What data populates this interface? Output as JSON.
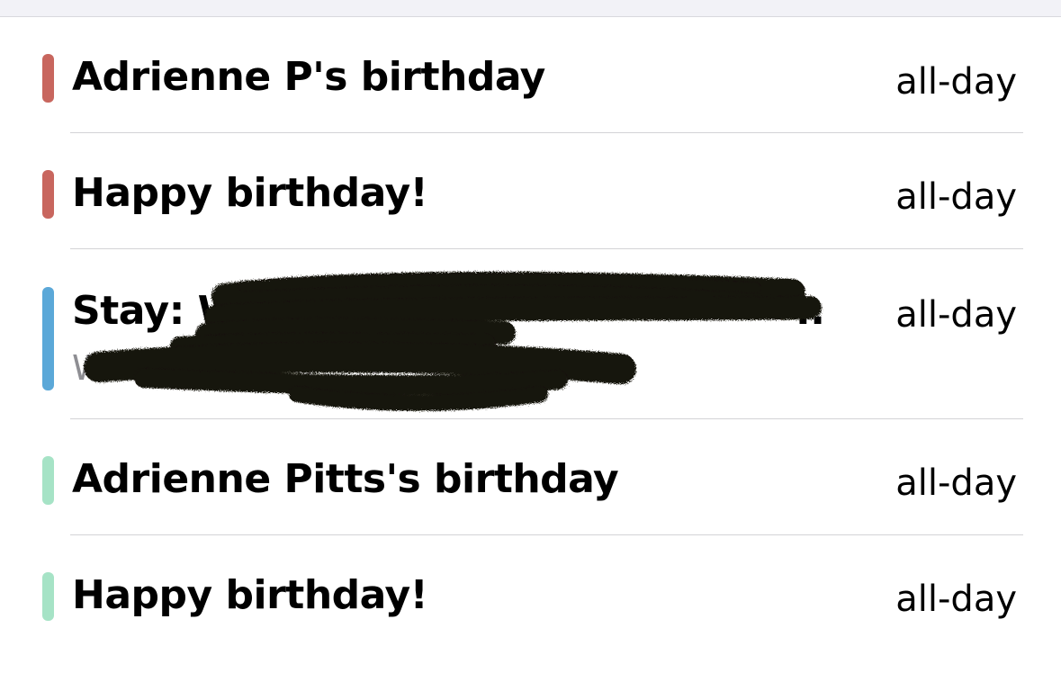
{
  "events": [
    {
      "title": "Adrienne P's birthday",
      "time": "all-day",
      "color": "#c8665e"
    },
    {
      "title": "Happy birthday!",
      "time": "all-day",
      "color": "#c8665e"
    },
    {
      "title": "Stay: W",
      "title_tail": "..",
      "subtitle": "W",
      "subtitle_tail": "n",
      "time": "all-day",
      "color": "#5ba8d8"
    },
    {
      "title": "Adrienne Pitts's birthday",
      "time": "all-day",
      "color": "#a6e3c6"
    },
    {
      "title": "Happy birthday!",
      "time": "all-day",
      "color": "#a6e3c6"
    }
  ]
}
